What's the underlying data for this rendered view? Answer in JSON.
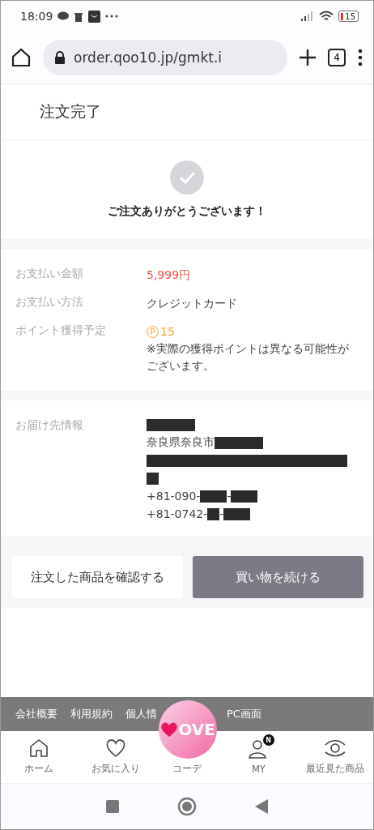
{
  "status_bar": {
    "time": "18:09",
    "battery": "15"
  },
  "browser": {
    "url": "order.qoo10.jp/gmkt.i",
    "tab_count": "4"
  },
  "page_title": "注文完了",
  "thanks": "ご注文ありがとうございます！",
  "payment": [
    {
      "label": "お支払い金額",
      "value": "5,999円",
      "kind": "price"
    },
    {
      "label": "お支払い方法",
      "value": "クレジットカード",
      "kind": "text"
    },
    {
      "label": "ポイント獲得予定",
      "value": "15",
      "point_mark": "P",
      "note": "※実際の獲得ポイントは異なる可能性がございます。",
      "kind": "points"
    }
  ],
  "delivery": {
    "label": "お届け先情報",
    "lines": [
      {
        "parts": [
          {
            "kind": "redacted_medium"
          }
        ]
      },
      {
        "parts": [
          {
            "kind": "text",
            "text": "奈良県奈良市"
          },
          {
            "kind": "redacted_medium"
          }
        ]
      },
      {
        "parts": [
          {
            "kind": "redacted_full"
          }
        ]
      },
      {
        "parts": [
          {
            "kind": "redacted_tiny"
          }
        ]
      },
      {
        "parts": [
          {
            "kind": "text",
            "text": "+81-090-"
          },
          {
            "kind": "redacted_short"
          },
          {
            "kind": "text",
            "text": "-"
          },
          {
            "kind": "redacted_short"
          }
        ]
      },
      {
        "parts": [
          {
            "kind": "text",
            "text": "+81-0742-"
          },
          {
            "kind": "redacted_tiny"
          },
          {
            "kind": "text",
            "text": "-"
          },
          {
            "kind": "redacted_short"
          }
        ]
      }
    ]
  },
  "buttons": [
    {
      "label": "注文した商品を確認する",
      "kind": "secondary"
    },
    {
      "label": "買い物を続ける",
      "kind": "primary"
    }
  ],
  "footer_links": [
    "会社概要",
    "利用規約",
    "個人情",
    "PC画面"
  ],
  "logo_text": "OVE",
  "bottom_nav": [
    {
      "label": "ホーム",
      "kind": "home"
    },
    {
      "label": "お気に入り",
      "kind": "heart"
    },
    {
      "label": "コーデ",
      "kind": "logo"
    },
    {
      "label": "MY",
      "kind": "person",
      "badge": "N"
    },
    {
      "label": "最近見た商品",
      "kind": "eye"
    }
  ]
}
